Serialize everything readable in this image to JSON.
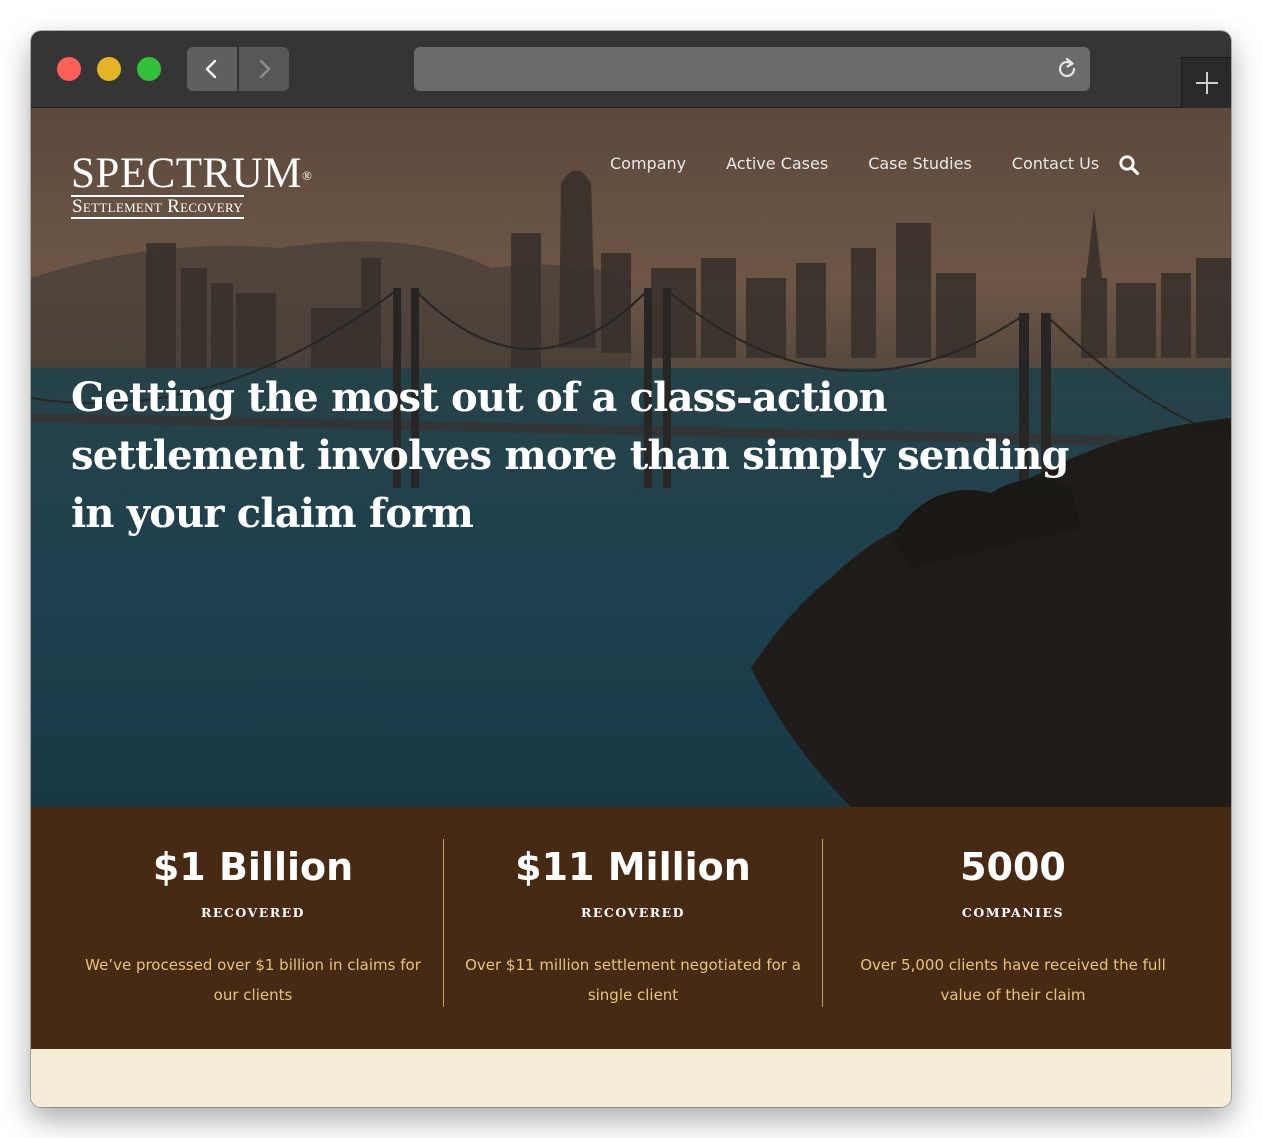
{
  "browser": {
    "url": ""
  },
  "site": {
    "logo": {
      "main": "SPECTRUM",
      "registered": "®",
      "sub": "Settlement Recovery"
    },
    "nav": {
      "items": [
        "Company",
        "Active Cases",
        "Case Studies",
        "Contact Us"
      ]
    },
    "hero": {
      "headline": "Getting the most out of a class-action settlement involves more than simply sending in your claim form"
    },
    "stats": [
      {
        "value": "$1 Billion",
        "label": "RECOVERED",
        "description": "We’ve processed over $1 billion in claims for our clients"
      },
      {
        "value": "$11 Million",
        "label": "RECOVERED",
        "description": "Over $11 million settlement negotiated for a single client"
      },
      {
        "value": "5000",
        "label": "COMPANIES",
        "description": "Over 5,000 clients have received the full value of their claim"
      }
    ]
  },
  "colors": {
    "chrome": "#353535",
    "stats_bg": "#472a14",
    "stats_desc": "#e8c37a",
    "page_bg": "#f6edd8"
  },
  "icons": [
    "back-arrow-icon",
    "forward-arrow-icon",
    "reload-icon",
    "new-tab-plus-icon",
    "search-icon"
  ]
}
